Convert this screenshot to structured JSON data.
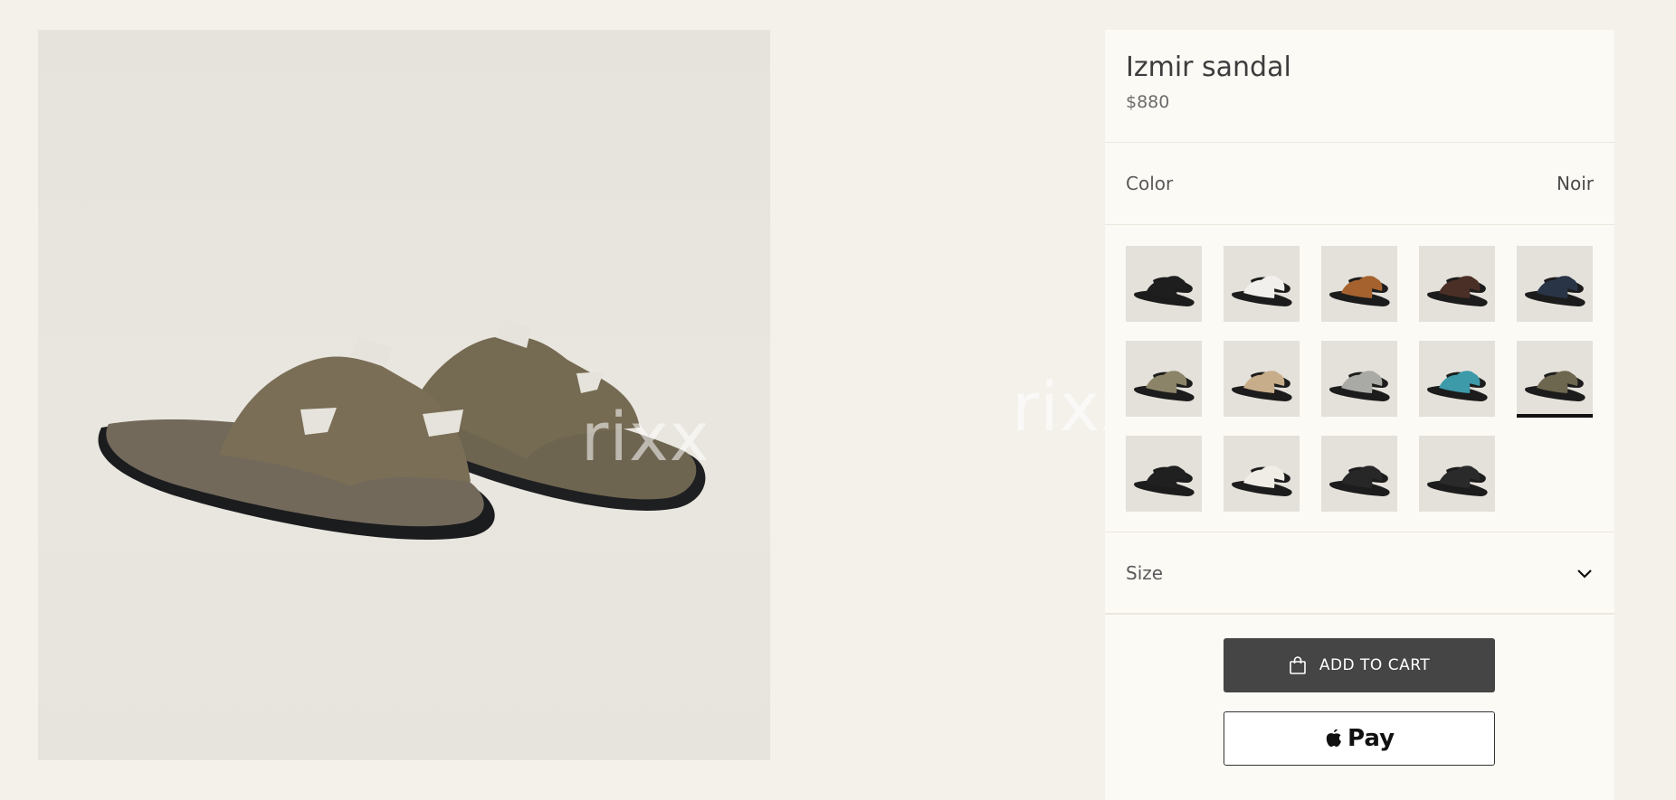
{
  "product": {
    "title": "Izmir sandal",
    "price": "$880"
  },
  "color": {
    "label": "Color",
    "selected": "Noir"
  },
  "swatches": [
    {
      "name": "black",
      "color": "#1e1e1e"
    },
    {
      "name": "white",
      "color": "#f2f0ec"
    },
    {
      "name": "tan",
      "color": "#a5612e"
    },
    {
      "name": "brown",
      "color": "#4a2f26"
    },
    {
      "name": "navy",
      "color": "#2a3447"
    },
    {
      "name": "khaki",
      "color": "#8c8468"
    },
    {
      "name": "beige",
      "color": "#c8ad8a"
    },
    {
      "name": "grey",
      "color": "#a9a9a5"
    },
    {
      "name": "turquoise",
      "color": "#3d9aa8"
    },
    {
      "name": "olive",
      "color": "#6d6750"
    },
    {
      "name": "black-2",
      "color": "#202020"
    },
    {
      "name": "white-tan",
      "color": "#f0ede7"
    },
    {
      "name": "black-3",
      "color": "#272727"
    },
    {
      "name": "black-orange",
      "color": "#2a2a2a"
    }
  ],
  "selected_swatch_index": 9,
  "size": {
    "label": "Size"
  },
  "buttons": {
    "add_to_cart": "ADD TO CART",
    "pay": "Pay"
  },
  "watermark": "rixx",
  "icons": [
    "bag-icon",
    "apple-icon",
    "chevron-down-icon"
  ],
  "colors": {
    "cart_button": "#454545",
    "background": "#f4f1eb",
    "panel": "#fcfaf5"
  }
}
